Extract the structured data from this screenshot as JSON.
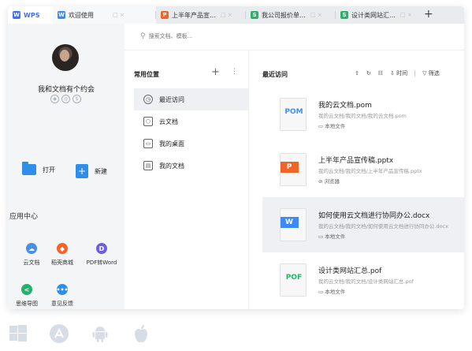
{
  "tabs": [
    {
      "label": "WPS",
      "icon": "wps-logo-icon",
      "color": "#3d6ef7"
    },
    {
      "label": "欢迎使用",
      "icon": "word-doc-icon",
      "color": "#3d8af7"
    },
    {
      "label": "上半年产品宣…",
      "icon": "ppt-doc-icon",
      "color": "#f0642a"
    },
    {
      "label": "我公司报价单…",
      "icon": "sheet-doc-icon",
      "color": "#2ab26b"
    },
    {
      "label": "设计类网站汇…",
      "icon": "sheet-doc-icon",
      "color": "#2ab26b"
    }
  ],
  "tab_controls": "□  ×",
  "new_tab": "+",
  "search": {
    "placeholder": "搜索文档、模板..."
  },
  "user": {
    "name": "我和文档有个约会"
  },
  "quick_actions": {
    "open": "打开",
    "new": "新建"
  },
  "app_center": {
    "title": "应用中心",
    "apps": [
      {
        "label": "云文档",
        "icon": "cloud-doc-icon",
        "color": "#4a90e2"
      },
      {
        "label": "稻壳商城",
        "icon": "docer-store-icon",
        "color": "#f5622a"
      },
      {
        "label": "PDF转Word",
        "icon": "pdf-to-word-icon",
        "color": "#6f5ce0"
      },
      {
        "label": "思维导图",
        "icon": "mind-map-icon",
        "color": "#23b26b"
      },
      {
        "label": "意见反馈",
        "icon": "feedback-icon",
        "color": "#2f8ee8"
      }
    ]
  },
  "locations": {
    "title": "常用位置",
    "add": "+",
    "more": "⋮",
    "items": [
      {
        "label": "最近访问",
        "icon": "clock-icon"
      },
      {
        "label": "云文档",
        "icon": "cloud-box-icon"
      },
      {
        "label": "我的桌面",
        "icon": "desktop-icon"
      },
      {
        "label": "我的文档",
        "icon": "documents-icon"
      }
    ]
  },
  "recent": {
    "title": "最近访问",
    "sort_label": "时间",
    "filter_label": "筛选",
    "files": [
      {
        "name": "我的云文档.pom",
        "path": "我的云文档/我的文档/我的云文档.pom",
        "location": "本地文件",
        "tag": "POM",
        "color": "#3f8ff0"
      },
      {
        "name": "上半年产品宣传稿.pptx",
        "path": "我的云文档/我的文档/上半年产品宣传稿.pptx",
        "location": "浏览器",
        "tag": "P",
        "color": "#f0642a"
      },
      {
        "name": "如何使用云文档进行协同办公.docx",
        "path": "我的云文档/我的文档/如何使用云文档进行协同办公.docx",
        "location": "本地文件",
        "tag": "W",
        "color": "#3d8af7"
      },
      {
        "name": "设计类网站汇总.pof",
        "path": "我的云文档/我的文档/设计类网站汇总.pof",
        "location": "本地文件",
        "tag": "POF",
        "color": "#2ab26b"
      }
    ]
  },
  "platforms": [
    "windows-icon",
    "appstore-icon",
    "android-icon",
    "apple-icon"
  ]
}
